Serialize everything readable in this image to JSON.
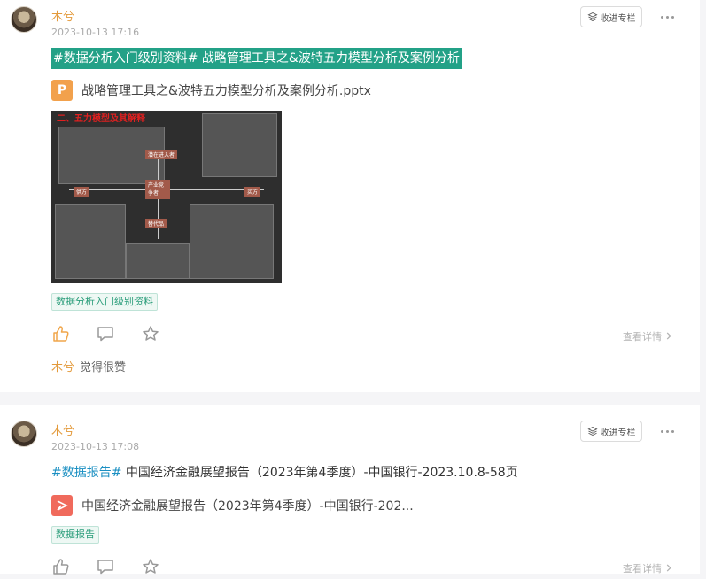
{
  "posts": [
    {
      "author": "木兮",
      "time": "2023-10-13 17:16",
      "collect_label": "收进专栏",
      "title": "#数据分析入门级别资料# 战略管理工具之&波特五力模型分析及案例分析",
      "file_name": "战略管理工具之&波特五力模型分析及案例分析.pptx",
      "file_icon": "P",
      "topic": "数据分析入门级别资料",
      "detail": "查看详情",
      "liked_by": "木兮",
      "liked_text": "觉得很赞",
      "thumb_heading": "二、五力模型及其解释"
    },
    {
      "author": "木兮",
      "time": "2023-10-13 17:08",
      "collect_label": "收进专栏",
      "title_tag": "#数据报告#",
      "title_text": " 中国经济金融展望报告（2023年第4季度）-中国银行-2023.10.8-58页",
      "file_name": "中国经济金融展望报告（2023年第4季度）-中国银行-202...",
      "topic": "数据报告",
      "detail": "查看详情"
    }
  ],
  "colors": {
    "accent": "#e39a3b",
    "topic_green": "#23a187",
    "link_blue": "#1a8fc2"
  },
  "icons": [
    "avatar",
    "bookmark-icon",
    "more-icon",
    "ppt-file-icon",
    "pdf-file-icon",
    "thumbs-up-icon",
    "comment-icon",
    "star-icon",
    "chevron-right-icon"
  ]
}
